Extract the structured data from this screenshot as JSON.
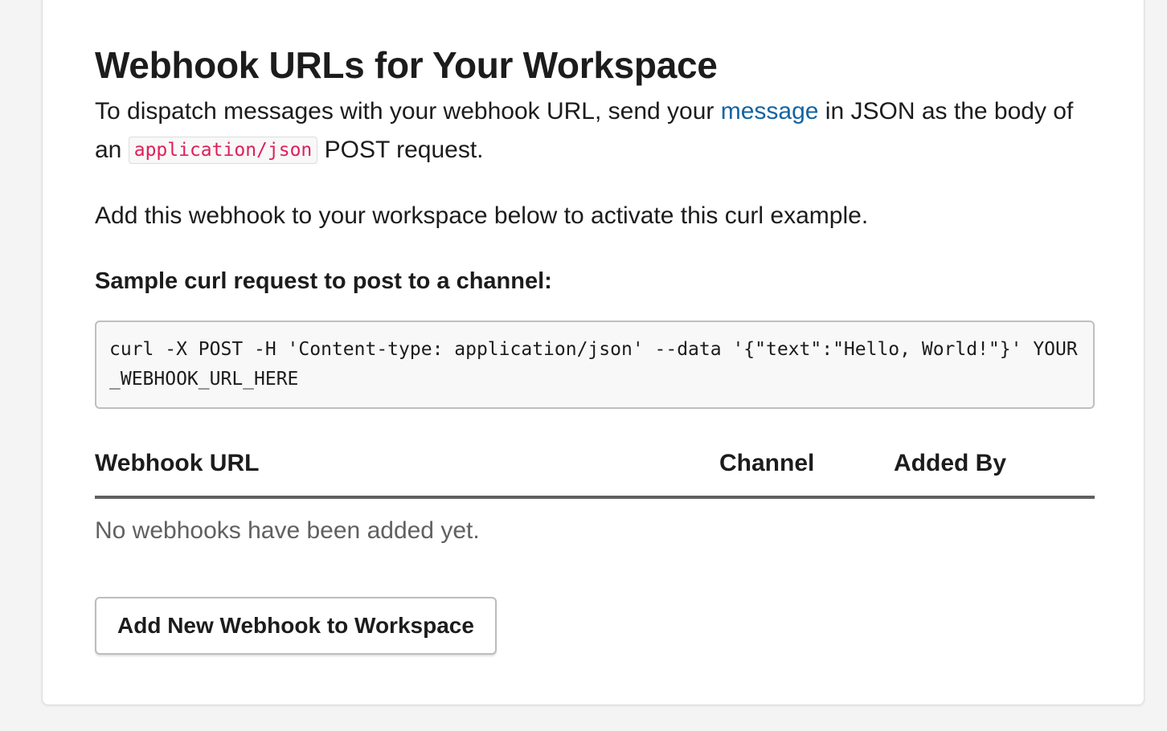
{
  "page": {
    "title": "Webhook URLs for Your Workspace"
  },
  "intro": {
    "text_before_link": "To dispatch messages with your webhook URL, send your ",
    "link_label": "message",
    "text_after_link": " in JSON as the body of an ",
    "inline_code": "application/json",
    "text_end": " POST request."
  },
  "activate_text": "Add this webhook to your workspace below to activate this curl example.",
  "sample": {
    "label": "Sample curl request to post to a channel:",
    "code": "curl -X POST -H 'Content-type: application/json' --data '{\"text\":\"Hello, World!\"}' YOUR_WEBHOOK_URL_HERE"
  },
  "table": {
    "columns": [
      "Webhook URL",
      "Channel",
      "Added By"
    ],
    "empty_message": "No webhooks have been added yet."
  },
  "actions": {
    "add_button_label": "Add New Webhook to Workspace"
  },
  "colors": {
    "link": "#1264a3",
    "inline_code": "#e01e5a",
    "page_background": "#f4f4f4",
    "card_background": "#ffffff"
  }
}
